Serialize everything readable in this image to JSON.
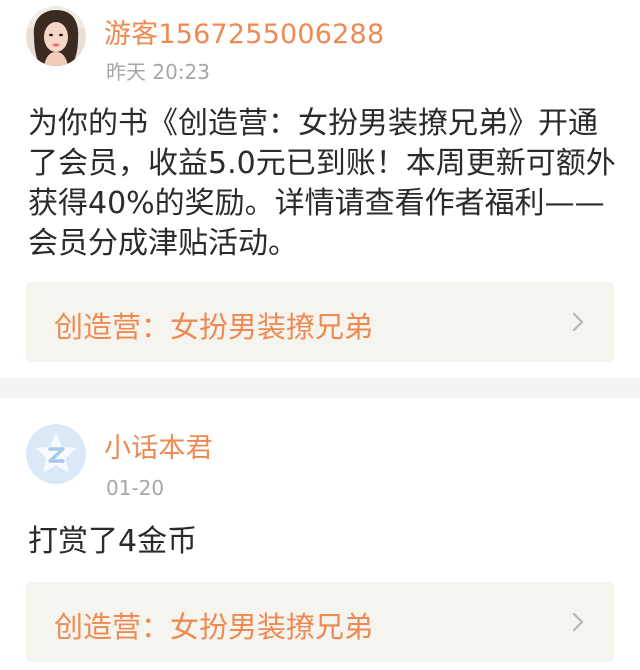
{
  "feed": [
    {
      "username": "游客1567255006288",
      "timestamp": "昨天 20:23",
      "message": "为你的书《创造营：女扮男装撩兄弟》开通了会员，收益5.0元已到账！本周更新可额外获得40%的奖励。详情请查看作者福利——会员分成津贴活动。",
      "book_title": "创造营：女扮男装撩兄弟",
      "avatar_icon": "user-photo-avatar"
    },
    {
      "username": "小话本君",
      "timestamp": "01-20",
      "message": "打赏了4金币",
      "book_title": "创造营：女扮男装撩兄弟",
      "avatar_icon": "app-logo-avatar"
    }
  ],
  "colors": {
    "accent": "#ee8a51",
    "timestamp": "#a6a6a6",
    "text": "#2b2b2b",
    "link_bg": "#f5f4ef",
    "divider": "#f3f3f3"
  }
}
